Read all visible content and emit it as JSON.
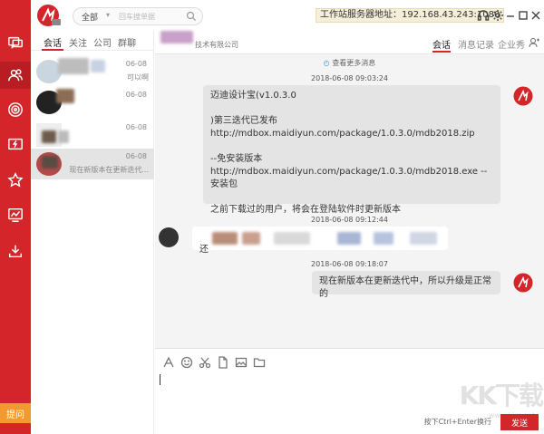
{
  "search": {
    "scope": "全部",
    "placeholder": "回车搜单据"
  },
  "server": {
    "text": "工作站服务器地址：192.168.43.243:1080"
  },
  "list_tabs": [
    "会话",
    "关注",
    "公司",
    "群聊"
  ],
  "conversations": [
    {
      "time": "06-08",
      "snippet": "可以啊"
    },
    {
      "time": "06-08",
      "snippet": ""
    },
    {
      "time": "06-08",
      "snippet": ""
    },
    {
      "time": "06-08",
      "snippet": "现在新版本在更新迭代..."
    }
  ],
  "chat": {
    "company": "技术有限公司",
    "tabs": [
      "会话",
      "消息记录",
      "企业秀"
    ],
    "more_msgs": "查看更多消息",
    "messages": [
      {
        "time": "2018-06-08 09:03:24",
        "text": "迈迪设计宝(v1.0.3.0\n\n)第三迭代已发布\nhttp://mdbox.maidiyun.com/package/1.0.3.0/mdb2018.zip\n\n  --免安装版本\nhttp://mdbox.maidiyun.com/package/1.0.3.0/mdb2018.exe  --安装包\n\n之前下载过的用户，将会在登陆软件时更新版本"
      },
      {
        "time": "2018-06-08 09:12:44",
        "text": "还"
      },
      {
        "time": "2018-06-08 09:18:07",
        "text": "现在新版本在更新迭代中，所以升级是正常的"
      }
    ]
  },
  "input": {
    "hint": "按下Ctrl+Enter换行",
    "send": "发送"
  },
  "feedback": "提问",
  "watermark": {
    "big": "KK下载",
    "small": "www.kkx.net"
  },
  "colors": {
    "brand_red": "#d4252b",
    "feedback_orange": "#f29a2e",
    "server_bg": "#f5eed8"
  }
}
